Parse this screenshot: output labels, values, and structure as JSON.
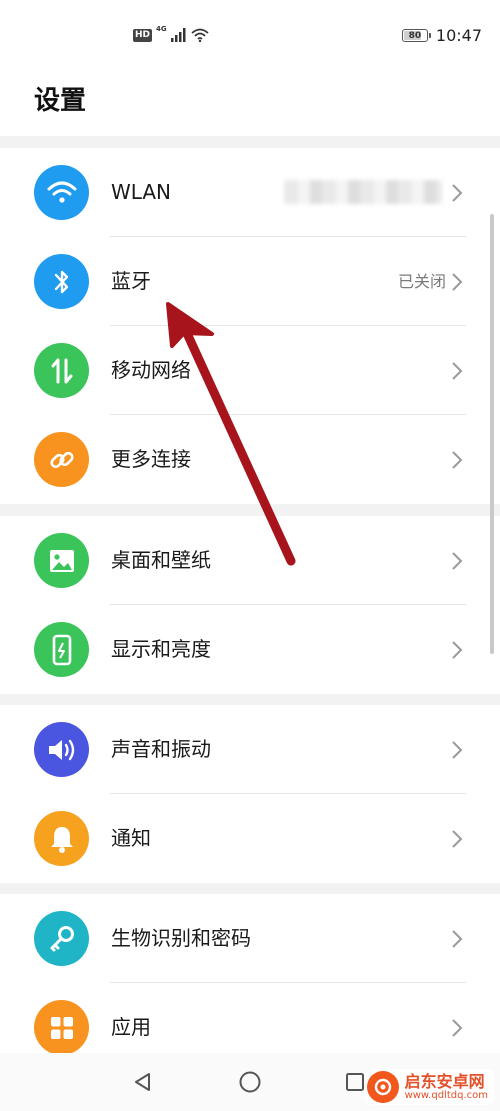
{
  "status_bar": {
    "hd": "HD",
    "network": "4G",
    "battery": "80",
    "battery_level": 0.8,
    "time": "10:47"
  },
  "page": {
    "title": "设置"
  },
  "groups": [
    {
      "rows": [
        {
          "label": "WLAN",
          "value": "",
          "icon": "wifi-icon",
          "color": "#1f9bf0"
        },
        {
          "label": "蓝牙",
          "value": "已关闭",
          "icon": "bluetooth-icon",
          "color": "#1f9bf0"
        },
        {
          "label": "移动网络",
          "value": "",
          "icon": "mobile-data-icon",
          "color": "#3bc45a"
        },
        {
          "label": "更多连接",
          "value": "",
          "icon": "link-icon",
          "color": "#f7931e"
        }
      ]
    },
    {
      "rows": [
        {
          "label": "桌面和壁纸",
          "value": "",
          "icon": "wallpaper-icon",
          "color": "#3bc45a"
        },
        {
          "label": "显示和亮度",
          "value": "",
          "icon": "display-icon",
          "color": "#3bc45a"
        }
      ]
    },
    {
      "rows": [
        {
          "label": "声音和振动",
          "value": "",
          "icon": "sound-icon",
          "color": "#4a55e0"
        },
        {
          "label": "通知",
          "value": "",
          "icon": "bell-icon",
          "color": "#f7a21e"
        }
      ]
    },
    {
      "rows": [
        {
          "label": "生物识别和密码",
          "value": "",
          "icon": "key-icon",
          "color": "#1fb5c6"
        },
        {
          "label": "应用",
          "value": "",
          "icon": "apps-icon",
          "color": "#f7931e"
        }
      ]
    }
  ],
  "annotation": {
    "arrow_color": "#a8141c"
  },
  "watermark": {
    "name": "启东安卓网",
    "url": "www.qdltdq.com"
  }
}
